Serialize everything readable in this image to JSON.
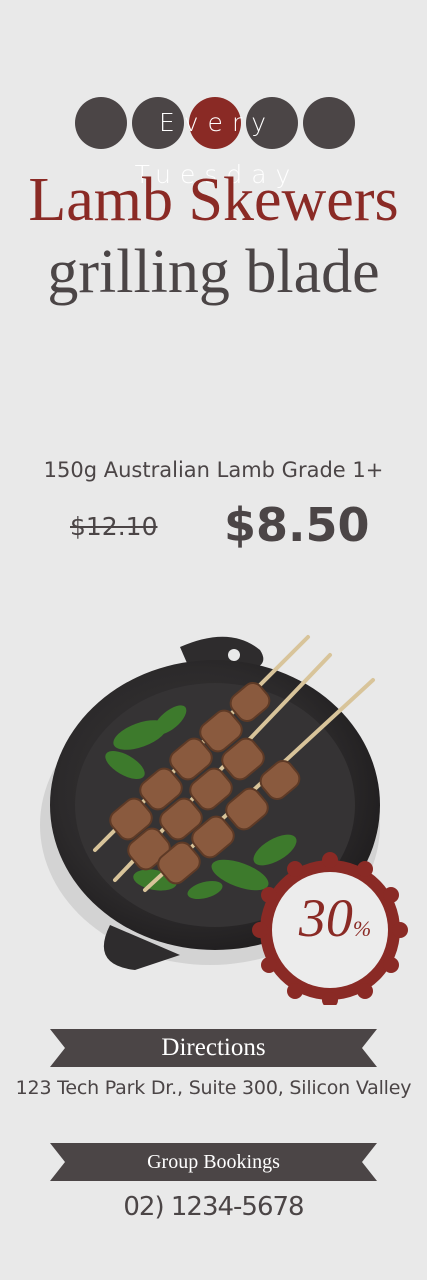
{
  "promo": {
    "day_label": "Every Tuesday",
    "title_line1": "Lamb Skewers",
    "title_line2": "grilling blade"
  },
  "product": {
    "description": "150g Australian Lamb Grade 1+",
    "old_price": "$12.10",
    "new_price": "$8.50"
  },
  "discount_badge": {
    "value": "30",
    "unit": "%"
  },
  "directions": {
    "label": "Directions",
    "address": "123 Tech Park Dr., Suite 300, Silicon Valley"
  },
  "bookings": {
    "label": "Group Bookings",
    "phone": "02) 1234-5678"
  },
  "colors": {
    "accent": "#8a2a25",
    "dark": "#4b4546",
    "background": "#e9e9e9"
  }
}
